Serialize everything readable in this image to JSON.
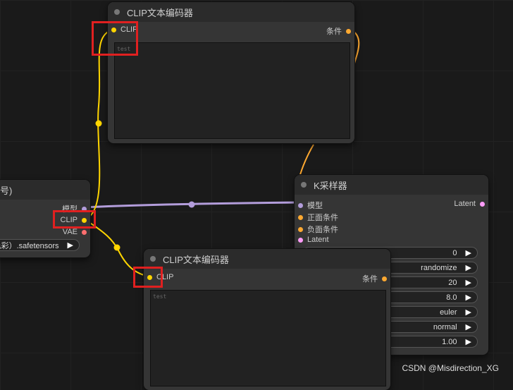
{
  "node_top": {
    "title": "CLIP文本编码器",
    "input_label": "CLIP",
    "output_label": "条件",
    "text": "test"
  },
  "node_bottom": {
    "title": "CLIP文本编码器",
    "input_label": "CLIP",
    "output_label": "条件",
    "text": "test"
  },
  "node_checkpoint": {
    "title_fragment": "号)",
    "outputs": [
      "模型",
      "CLIP",
      "VAE"
    ],
    "ckpt_value": "色彩）.safetensors"
  },
  "node_ksampler": {
    "title": "K采样器",
    "inputs": [
      "模型",
      "正面条件",
      "负面条件",
      "Latent"
    ],
    "output_label": "Latent",
    "widget_values": [
      "0",
      "randomize",
      "20",
      "8.0",
      "euler",
      "normal",
      "1.00"
    ]
  },
  "watermark": "CSDN @Misdirection_XG",
  "colors": {
    "clip": "#ffd500",
    "conditioning": "#ffa931",
    "model": "#b39ddb",
    "latent": "#ff9cf9",
    "vae": "#ff6e6e",
    "highlight": "#e02020"
  }
}
